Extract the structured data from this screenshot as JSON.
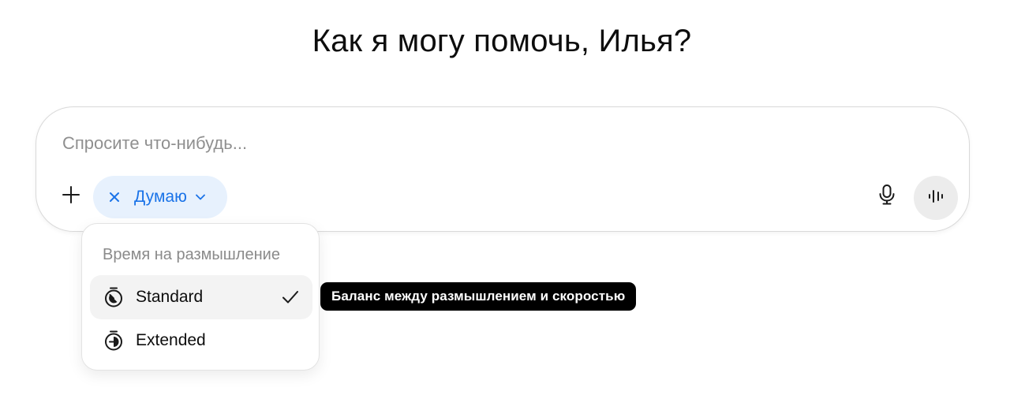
{
  "header": {
    "greeting": "Как я могу помочь, Илья?"
  },
  "composer": {
    "placeholder": "Спросите что-нибудь...",
    "value": "",
    "plus_icon": "plus-icon",
    "mic_icon": "microphone-icon",
    "voice_icon": "voice-waveform-icon",
    "think_chip": {
      "label": "Думаю",
      "remove_icon": "close-icon",
      "dropdown_icon": "chevron-down-icon",
      "accent_color": "#1a73e8",
      "background_color": "#e7f1fd"
    }
  },
  "thinking_menu": {
    "heading": "Время на размышление",
    "options": [
      {
        "label": "Standard",
        "icon": "stopwatch-icon",
        "selected": true
      },
      {
        "label": "Extended",
        "icon": "stopwatch-icon",
        "selected": false
      }
    ],
    "check_icon": "checkmark-icon"
  },
  "tooltip": {
    "text": "Баланс между размышлением и скоростью"
  }
}
